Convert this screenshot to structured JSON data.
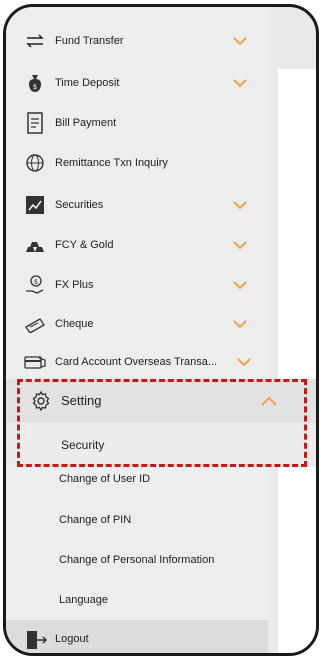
{
  "menu": {
    "items": [
      {
        "label": "Fund Transfer",
        "icon": "transfer-arrows-icon",
        "expandable": true
      },
      {
        "label": "Time Deposit",
        "icon": "money-bag-icon",
        "expandable": true
      },
      {
        "label": "Bill Payment",
        "icon": "bill-icon",
        "expandable": false
      },
      {
        "label": "Remittance Txn Inquiry",
        "icon": "globe-icon",
        "expandable": false
      },
      {
        "label": "Securities",
        "icon": "securities-chart-icon",
        "expandable": true
      },
      {
        "label": "FCY & Gold",
        "icon": "gold-bars-icon",
        "expandable": true
      },
      {
        "label": "FX Plus",
        "icon": "fx-hand-coin-icon",
        "expandable": true
      },
      {
        "label": "Cheque",
        "icon": "cheque-icon",
        "expandable": true
      },
      {
        "label": "Card Account Overseas Transa...",
        "icon": "card-icon",
        "expandable": true
      }
    ],
    "setting": {
      "label": "Setting",
      "icon": "gear-icon",
      "expanded": true
    },
    "setting_sub": {
      "security": "Security",
      "change_user_id": "Change of User ID",
      "change_pin": "Change of PIN",
      "change_personal_info": "Change of Personal Information",
      "language": "Language"
    },
    "logout": {
      "label": "Logout",
      "icon": "logout-icon"
    }
  },
  "colors": {
    "chevron": "#f0a24a",
    "highlight_border": "#c21a1a",
    "menu_bg": "#ededed"
  }
}
